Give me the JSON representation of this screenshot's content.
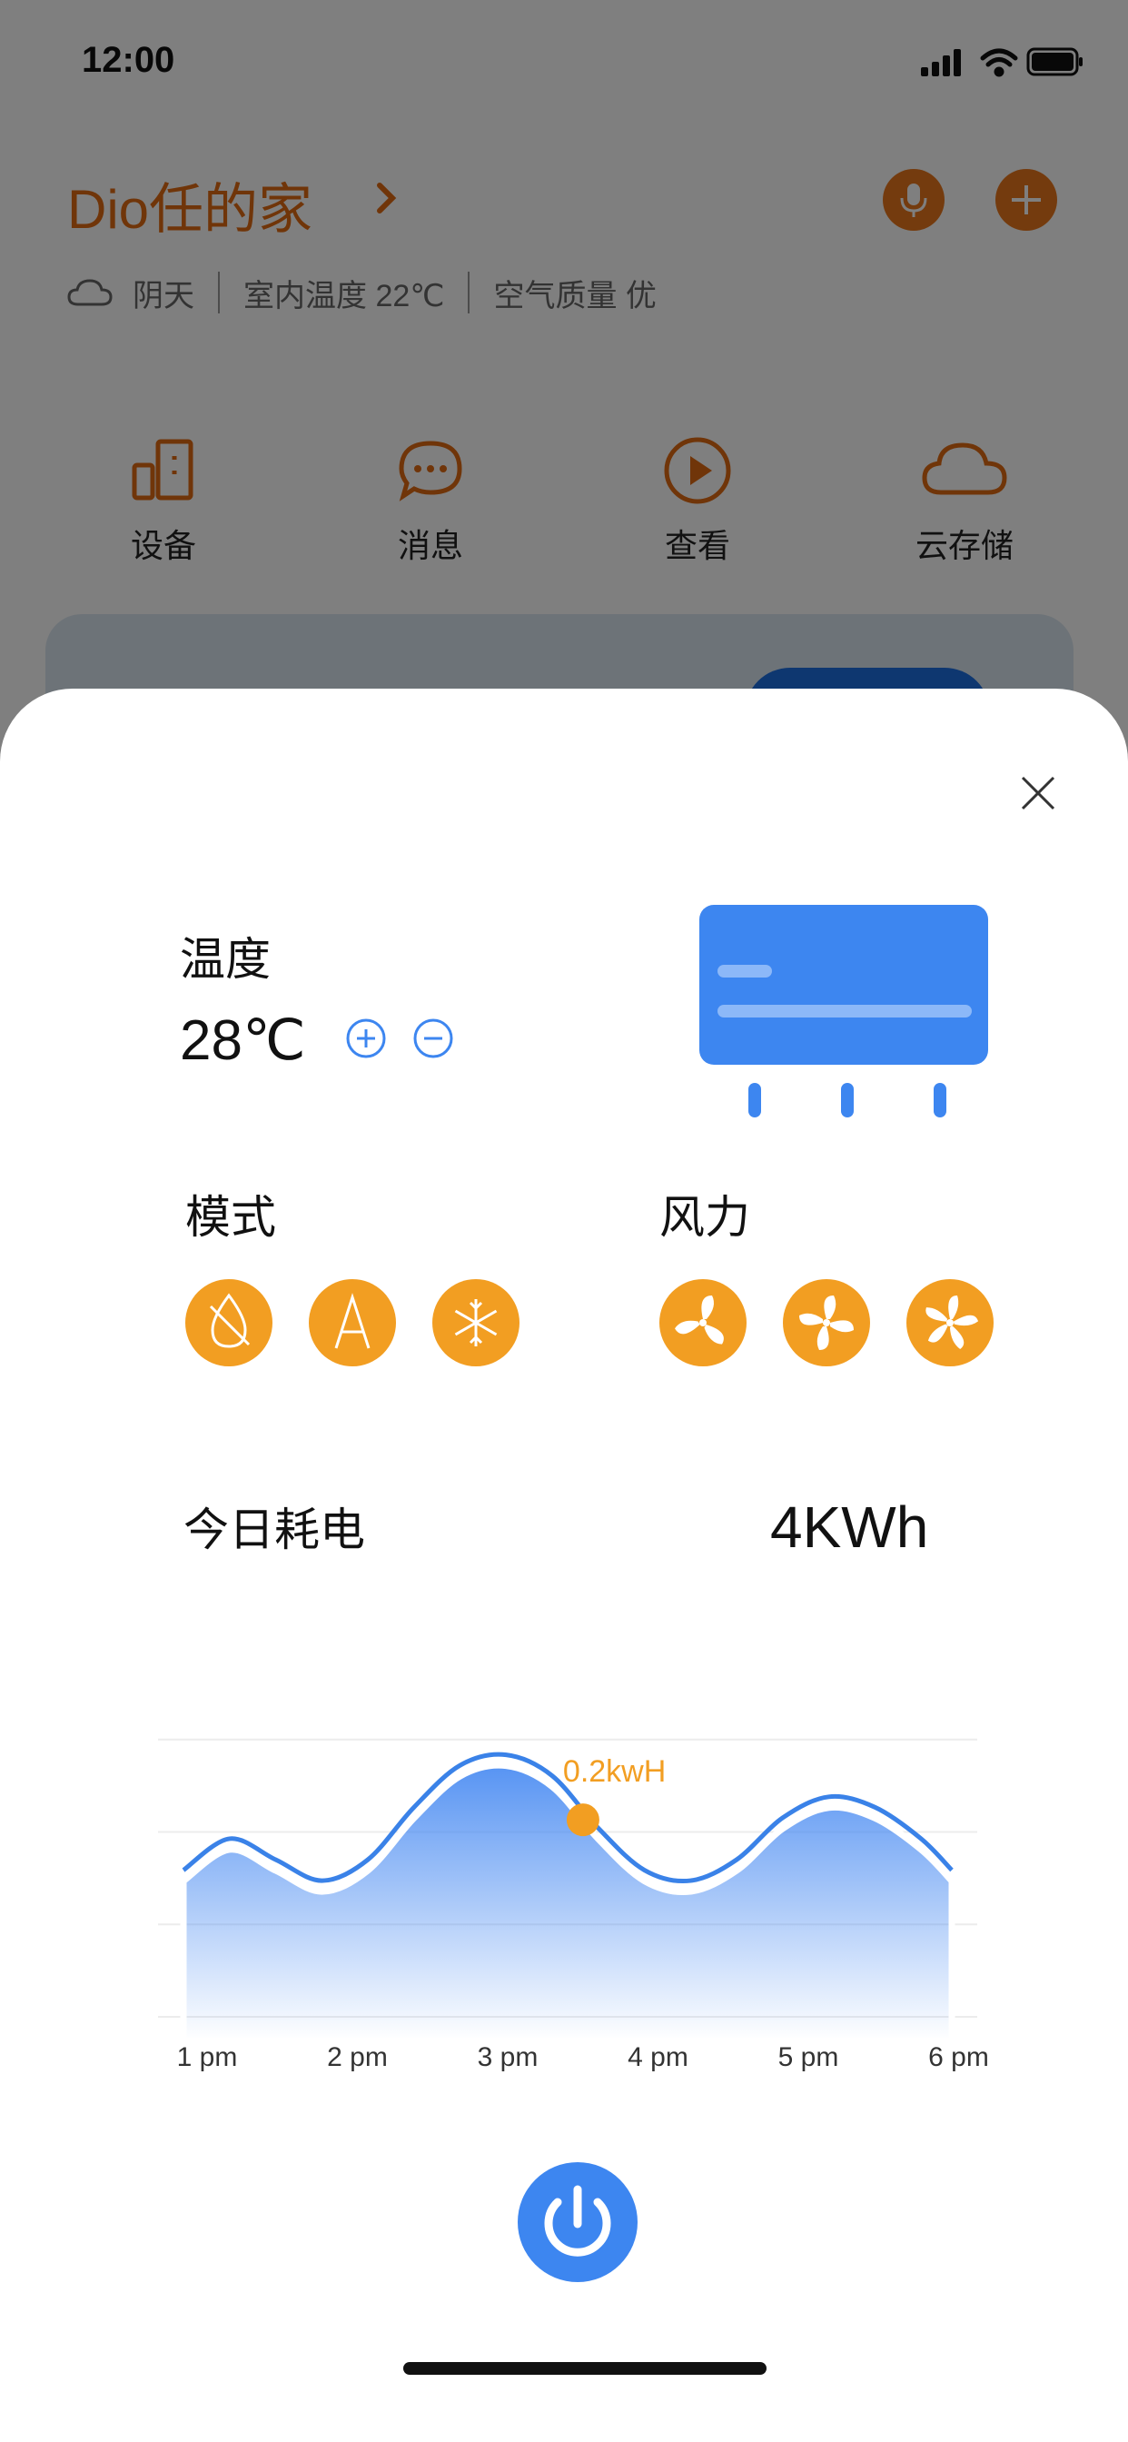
{
  "status_bar": {
    "time": "12:00"
  },
  "home": {
    "title": "Dio任的家",
    "weather": "阴天",
    "indoor_temp": "室内温度 22℃",
    "air_quality": "空气质量 优",
    "quick_actions": [
      {
        "label": "设备",
        "icon": "device-icon"
      },
      {
        "label": "消息",
        "icon": "message-icon"
      },
      {
        "label": "查看",
        "icon": "play-icon"
      },
      {
        "label": "云存储",
        "icon": "cloud-icon"
      }
    ]
  },
  "sheet": {
    "temperature": {
      "title": "温度",
      "value": "28℃"
    },
    "mode": {
      "title": "模式",
      "icons": [
        "dehumidify-icon",
        "auto-icon",
        "snowflake-icon"
      ]
    },
    "fan": {
      "title": "风力",
      "icons": [
        "fan-low-icon",
        "fan-medium-icon",
        "fan-high-icon"
      ]
    },
    "energy": {
      "title": "今日耗电",
      "value": "4KWh"
    }
  },
  "colors": {
    "accent_orange": "#f29e22",
    "brand_orange": "#e16b12",
    "accent_blue": "#3d86f0",
    "line_blue": "#3a82e8"
  },
  "chart_data": {
    "type": "area",
    "x": [
      "1 pm",
      "2 pm",
      "3 pm",
      "4 pm",
      "5 pm",
      "6 pm"
    ],
    "annotation": "0.2kwH",
    "annotation_x": 3.6,
    "curve": [
      [
        1.0,
        0.14
      ],
      [
        1.3,
        0.17
      ],
      [
        1.6,
        0.15
      ],
      [
        1.9,
        0.13
      ],
      [
        2.2,
        0.15
      ],
      [
        2.5,
        0.2
      ],
      [
        2.8,
        0.24
      ],
      [
        3.1,
        0.25
      ],
      [
        3.4,
        0.23
      ],
      [
        3.7,
        0.18
      ],
      [
        4.0,
        0.14
      ],
      [
        4.3,
        0.13
      ],
      [
        4.6,
        0.15
      ],
      [
        4.9,
        0.19
      ],
      [
        5.2,
        0.21
      ],
      [
        5.5,
        0.2
      ],
      [
        5.8,
        0.17
      ],
      [
        6.0,
        0.14
      ]
    ],
    "ylim": [
      0,
      0.3
    ],
    "grid": true
  }
}
